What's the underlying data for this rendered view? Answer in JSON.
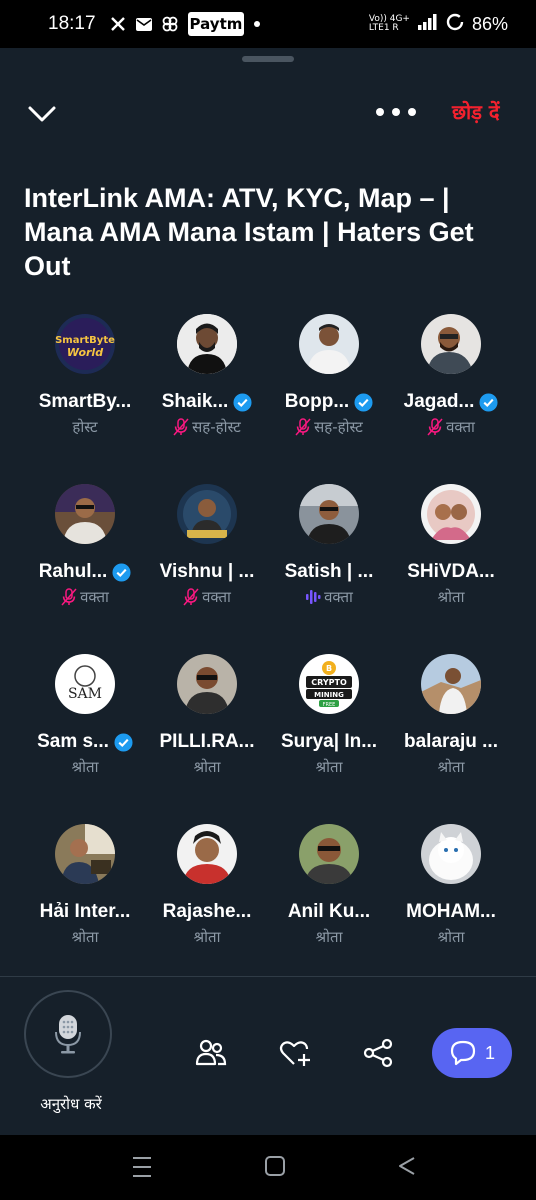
{
  "status": {
    "time": "18:17",
    "battery": "86%",
    "net_line1": "Vo)) 4G+",
    "net_line2": "LTE1 R",
    "paytm": "Paytm"
  },
  "space": {
    "leave_label": "छोड़ दें",
    "title": "InterLink AMA: ATV, KYC, Map – | Mana AMA Mana Istam | Haters Get Out"
  },
  "participants": [
    {
      "name": "SmartBy...",
      "role": "होस्ट",
      "verified": false,
      "mic": "none"
    },
    {
      "name": "Shaik...",
      "role": "सह-होस्ट",
      "verified": true,
      "mic": "muted"
    },
    {
      "name": "Bopp...",
      "role": "सह-होस्ट",
      "verified": true,
      "mic": "muted"
    },
    {
      "name": "Jagad...",
      "role": "वक्ता",
      "verified": true,
      "mic": "muted"
    },
    {
      "name": "Rahul...",
      "role": "वक्ता",
      "verified": true,
      "mic": "muted"
    },
    {
      "name": "Vishnu | ...",
      "role": "वक्ता",
      "verified": false,
      "mic": "muted"
    },
    {
      "name": "Satish | ...",
      "role": "वक्ता",
      "verified": false,
      "mic": "speaking"
    },
    {
      "name": "SHiVDA...",
      "role": "श्रोता",
      "verified": false,
      "mic": "none"
    },
    {
      "name": "Sam s...",
      "role": "श्रोता",
      "verified": true,
      "mic": "none"
    },
    {
      "name": "PILLI.RA...",
      "role": "श्रोता",
      "verified": false,
      "mic": "none"
    },
    {
      "name": "Surya| In...",
      "role": "श्रोता",
      "verified": false,
      "mic": "none"
    },
    {
      "name": "balaraju ...",
      "role": "श्रोता",
      "verified": false,
      "mic": "none"
    },
    {
      "name": "Hải Inter...",
      "role": "श्रोता",
      "verified": false,
      "mic": "none"
    },
    {
      "name": "Rajashe...",
      "role": "श्रोता",
      "verified": false,
      "mic": "none"
    },
    {
      "name": "Anil Ku...",
      "role": "श्रोता",
      "verified": false,
      "mic": "none"
    },
    {
      "name": "MOHAM...",
      "role": "श्रोता",
      "verified": false,
      "mic": "none"
    }
  ],
  "avatar_text": {
    "smartbyte": "SmartByte World",
    "sam": "SAM",
    "crypto": "CRYPTO MINING FREE"
  },
  "bottom": {
    "request_label": "अनुरोध करें",
    "chat_count": "1"
  },
  "colors": {
    "background": "#16202a",
    "accent": "#5865f2",
    "leave": "#f4212e",
    "verified": "#1d9bf0",
    "muted": "#f91880",
    "speaking": "#7856ff"
  }
}
